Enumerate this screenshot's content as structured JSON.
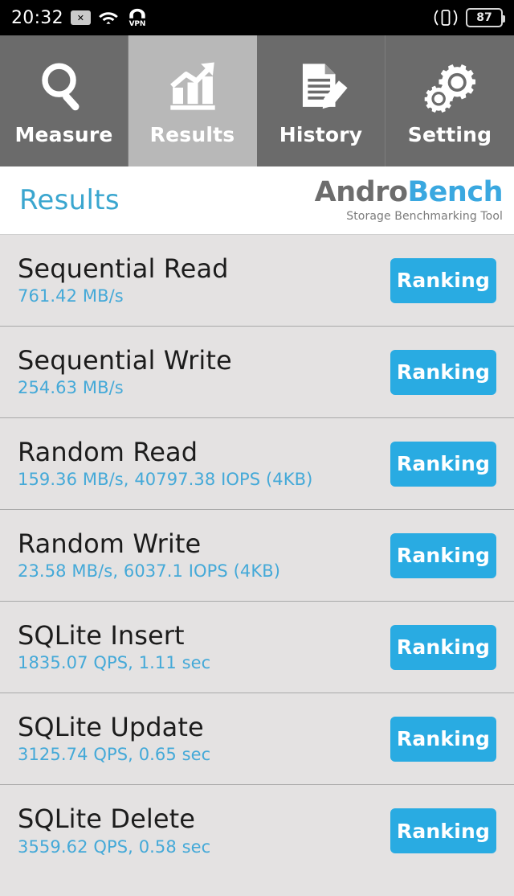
{
  "statusbar": {
    "clock": "20:32",
    "close_badge": "✕",
    "wifi_icon": "wifi-icon",
    "vpn_label": "VPN",
    "vibrate_icon": "vibrate-icon",
    "battery_level": "87"
  },
  "tabs": [
    {
      "label": "Measure",
      "icon": "magnifier-icon",
      "active": false
    },
    {
      "label": "Results",
      "icon": "bar-chart-arrow-icon",
      "active": true
    },
    {
      "label": "History",
      "icon": "document-pencil-icon",
      "active": false
    },
    {
      "label": "Setting",
      "icon": "gears-icon",
      "active": false
    }
  ],
  "header": {
    "page_title": "Results",
    "logo_andro": "Andro",
    "logo_bench": "Bench",
    "logo_tagline": "Storage Benchmarking Tool"
  },
  "results": [
    {
      "title": "Sequential Read",
      "value": "761.42 MB/s",
      "button": "Ranking"
    },
    {
      "title": "Sequential Write",
      "value": "254.63 MB/s",
      "button": "Ranking"
    },
    {
      "title": "Random Read",
      "value": "159.36 MB/s, 40797.38 IOPS (4KB)",
      "button": "Ranking"
    },
    {
      "title": "Random Write",
      "value": "23.58 MB/s, 6037.1 IOPS (4KB)",
      "button": "Ranking"
    },
    {
      "title": "SQLite Insert",
      "value": "1835.07 QPS, 1.11 sec",
      "button": "Ranking"
    },
    {
      "title": "SQLite Update",
      "value": "3125.74 QPS, 0.65 sec",
      "button": "Ranking"
    },
    {
      "title": "SQLite Delete",
      "value": "3559.62 QPS, 0.58 sec",
      "button": "Ranking"
    }
  ],
  "colors": {
    "accent_blue": "#29abe2",
    "value_blue": "#44a9d8",
    "title_blue": "#3aa6cf",
    "tab_inactive": "#6b6b6b",
    "tab_active": "#b8b8b8",
    "row_bg": "#e4e2e2",
    "statusbar_bg": "#000000"
  }
}
